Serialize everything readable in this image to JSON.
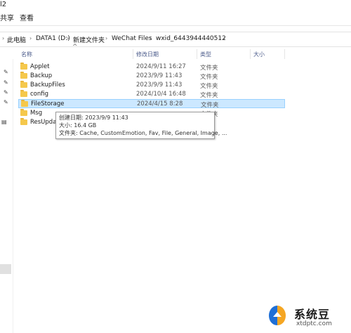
{
  "window": {
    "title_fragment": "l2"
  },
  "ribbon": {
    "tab_share": "共享",
    "tab_view": "查看"
  },
  "breadcrumb": [
    "此电脑",
    "DATA1 (D:)",
    "新建文件夹",
    "WeChat Files",
    "wxid_6443944440512"
  ],
  "columns": {
    "name": "名称",
    "date": "修改日期",
    "type": "类型",
    "size": "大小"
  },
  "files": [
    {
      "name": "Applet",
      "date": "2024/9/11 16:27",
      "type": "文件夹"
    },
    {
      "name": "Backup",
      "date": "2023/9/9 11:43",
      "type": "文件夹"
    },
    {
      "name": "BackupFiles",
      "date": "2023/9/9 11:43",
      "type": "文件夹"
    },
    {
      "name": "config",
      "date": "2024/10/4 16:48",
      "type": "文件夹"
    },
    {
      "name": "FileStorage",
      "date": "2024/4/15 8:28",
      "type": "文件夹",
      "selected": true
    },
    {
      "name": "Msg",
      "date": "",
      "type": "文件夹"
    },
    {
      "name": "ResUpdate",
      "date": "",
      "type": ""
    }
  ],
  "tooltip": {
    "created": "创建日期: 2023/9/9 11:43",
    "size": "大小: 16.4 GB",
    "folders": "文件夹: Cache, CustomEmotion, Fav, File, General, Image, ..."
  },
  "watermark": {
    "brand": "系统豆",
    "url": "xtdptc.com"
  },
  "colors": {
    "selection": "#cce8ff",
    "folder": "#f5c84c",
    "header_text": "#4a5a8a"
  }
}
